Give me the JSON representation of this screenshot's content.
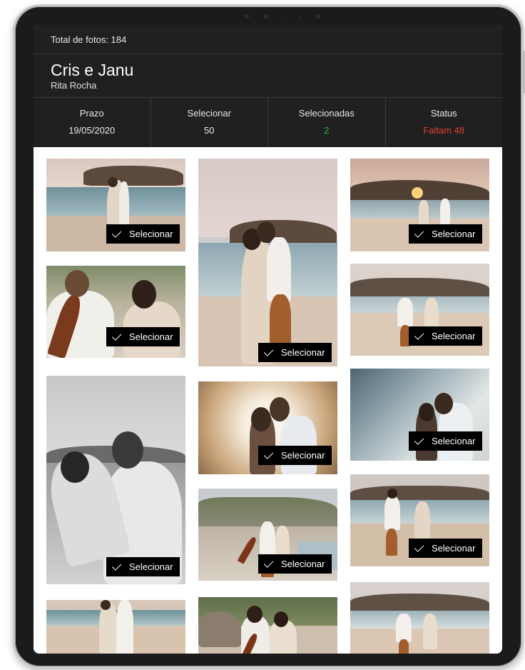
{
  "header": {
    "total_label": "Total de fotos: 184",
    "album_title": "Cris e Janu",
    "photographer": "Rita Rocha"
  },
  "stats": [
    {
      "label": "Prazo",
      "value": "19/05/2020"
    },
    {
      "label": "Selecionar",
      "value": "50"
    },
    {
      "label": "Selecionadas",
      "value": "2"
    },
    {
      "label": "Status",
      "value": "Faltam 48"
    }
  ],
  "colors": {
    "selected_count": "#22b04b",
    "status_remaining": "#e0412e"
  },
  "photos": [
    {
      "select_label": "Selecionar"
    },
    {
      "select_label": "Selecionar"
    },
    {
      "select_label": "Selecionar"
    },
    {
      "select_label": "Selecionar"
    },
    {
      "select_label": "Selecionar"
    },
    {
      "select_label": "Selecionar"
    },
    {
      "select_label": "Selecionar"
    },
    {
      "select_label": "Selecionar"
    },
    {
      "select_label": "Selecionar"
    },
    {
      "select_label": "Selecionar"
    },
    {
      "select_label": "Selecionar"
    }
  ],
  "icons": {
    "select": "check-icon"
  }
}
